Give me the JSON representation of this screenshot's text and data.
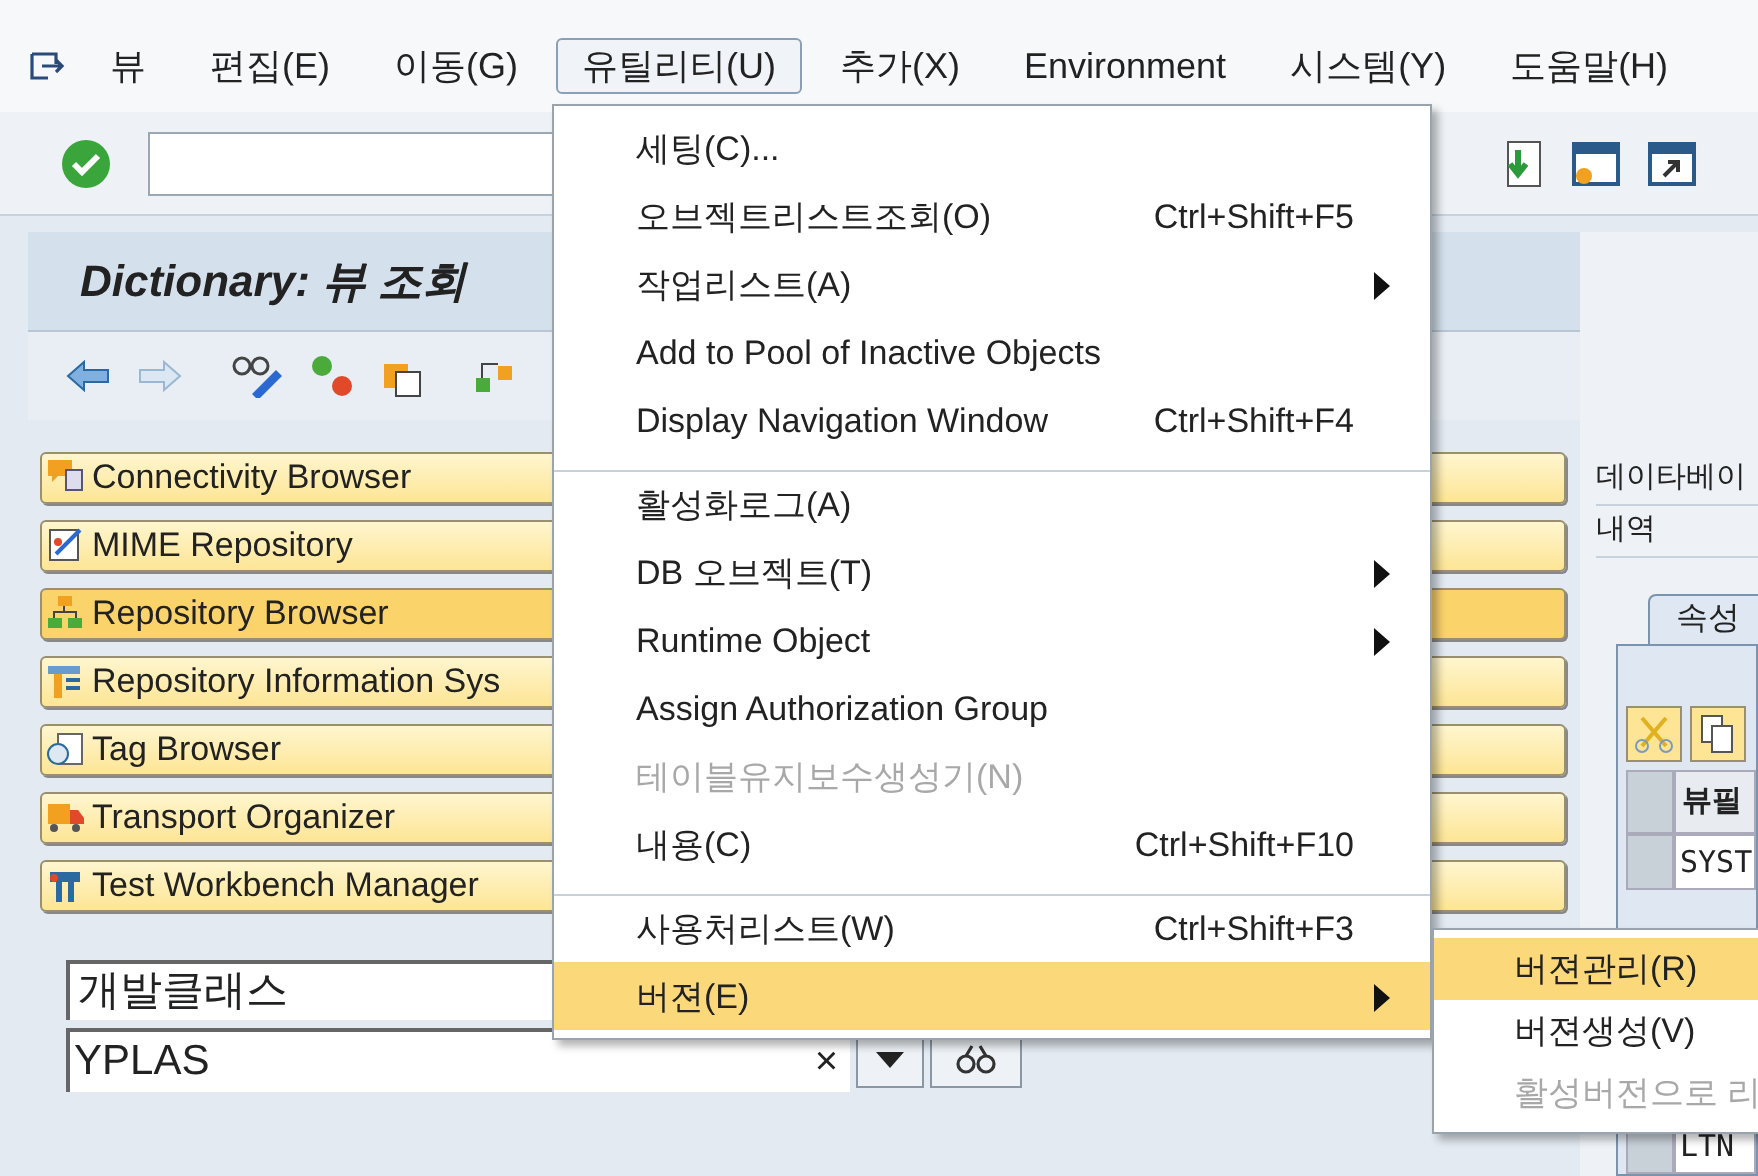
{
  "menu_bar": [
    {
      "label": "뷰",
      "selected": false
    },
    {
      "label": "편집(E)",
      "selected": false
    },
    {
      "label": "이동(G)",
      "selected": false
    },
    {
      "label": "유틸리티(U)",
      "selected": true
    },
    {
      "label": "추가(X)",
      "selected": false
    },
    {
      "label": "Environment",
      "selected": false
    },
    {
      "label": "시스템(Y)",
      "selected": false
    },
    {
      "label": "도움말(H)",
      "selected": false
    }
  ],
  "title": "Dictionary: 뷰 조회",
  "navigation_buttons": [
    {
      "label": "Connectivity Browser",
      "selected": false
    },
    {
      "label": "MIME Repository",
      "selected": false
    },
    {
      "label": "Repository Browser",
      "selected": true
    },
    {
      "label": "Repository Information Sys",
      "selected": false
    },
    {
      "label": "Tag Browser",
      "selected": false
    },
    {
      "label": "Transport Organizer",
      "selected": false
    },
    {
      "label": "Test Workbench Manager",
      "selected": false
    }
  ],
  "object_type_field": {
    "value": "개발클래스"
  },
  "object_name_field": {
    "value": "YPLAS",
    "clear": "×"
  },
  "right_panel": {
    "labels": [
      "데이타베이",
      "내역"
    ],
    "tab": {
      "label": "속성",
      "selected": true
    },
    "table": {
      "columns": [
        "뷰필"
      ],
      "rows": [
        "SYST",
        "LTN"
      ]
    }
  },
  "dropdown_menu": {
    "items": [
      {
        "label": "세팅(C)...",
        "submenu": false,
        "disabled": false,
        "selected": false,
        "separator_before": false
      },
      {
        "label": "오브젝트리스트조회(O)",
        "shortcut": "Ctrl+Shift+F5",
        "submenu": false,
        "disabled": false,
        "selected": false,
        "separator_before": false
      },
      {
        "label": "작업리스트(A)",
        "submenu": true,
        "disabled": false,
        "selected": false,
        "separator_before": false
      },
      {
        "label": "Add to Pool of Inactive Objects",
        "submenu": false,
        "disabled": false,
        "selected": false,
        "separator_before": false
      },
      {
        "label": "Display Navigation Window",
        "shortcut": "Ctrl+Shift+F4",
        "submenu": false,
        "disabled": false,
        "selected": false,
        "separator_before": false
      },
      {
        "label": "활성화로그(A)",
        "submenu": false,
        "disabled": false,
        "selected": false,
        "separator_before": true
      },
      {
        "label": "DB 오브젝트(T)",
        "submenu": true,
        "disabled": false,
        "selected": false,
        "separator_before": false
      },
      {
        "label": "Runtime Object",
        "submenu": true,
        "disabled": false,
        "selected": false,
        "separator_before": false
      },
      {
        "label": "Assign Authorization Group",
        "submenu": false,
        "disabled": false,
        "selected": false,
        "separator_before": false
      },
      {
        "label": "테이블유지보수생성기(N)",
        "submenu": false,
        "disabled": true,
        "selected": false,
        "separator_before": false
      },
      {
        "label": "내용(C)",
        "shortcut": "Ctrl+Shift+F10",
        "submenu": false,
        "disabled": false,
        "selected": false,
        "separator_before": false
      },
      {
        "label": "사용처리스트(W)",
        "shortcut": "Ctrl+Shift+F3",
        "submenu": false,
        "disabled": false,
        "selected": false,
        "separator_before": true
      },
      {
        "label": "버젼(E)",
        "submenu": true,
        "disabled": false,
        "selected": true,
        "separator_before": false
      }
    ]
  },
  "submenu": {
    "items": [
      {
        "label": "버젼관리(R)",
        "disabled": false,
        "selected": true
      },
      {
        "label": "버젼생성(V)",
        "disabled": false,
        "selected": false
      },
      {
        "label": "활성버전으로 리",
        "disabled": true,
        "selected": false
      }
    ]
  }
}
